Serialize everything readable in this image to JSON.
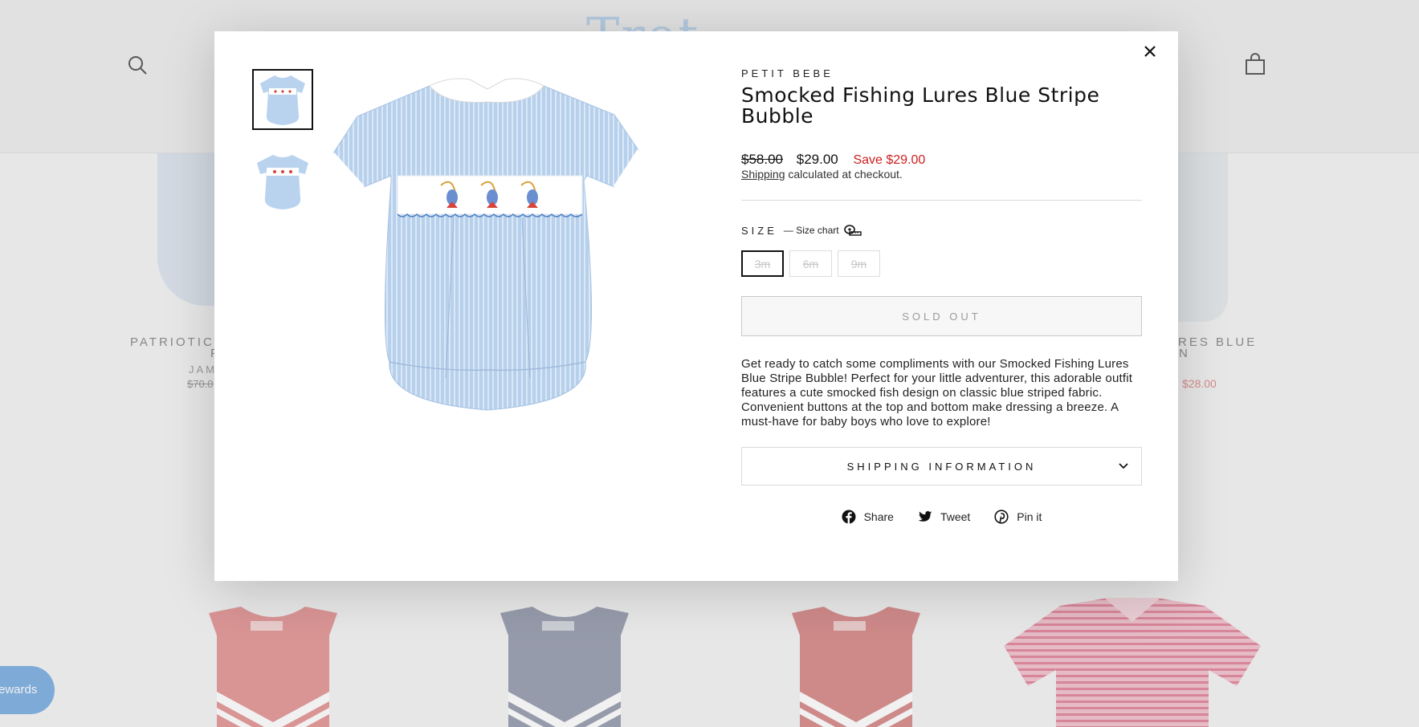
{
  "background": {
    "logo_text": "Trot",
    "cards_top": [
      {
        "title": "PATRIOTIC",
        "subtitle": "F",
        "vendor": "JAM",
        "price_old": "$70.0"
      },
      {
        "title": "RES BLUE",
        "subtitle": "N",
        "price_sale": "$28.00"
      }
    ],
    "rewards_label": "ewards"
  },
  "modal": {
    "close_label": "×",
    "vendor": "PETIT BEBE",
    "title": "Smocked Fishing Lures Blue Stripe Bubble",
    "price_compare": "$58.00",
    "price_current": "$29.00",
    "price_savings": "Save $29.00",
    "shipping_link": "Shipping",
    "shipping_rest": " calculated at checkout.",
    "size_label": "SIZE",
    "size_chart_label": "— Size chart",
    "sizes": [
      "3m",
      "6m",
      "9m"
    ],
    "selected_size": "3m",
    "sold_out_label": "SOLD OUT",
    "description": "Get ready to catch some compliments with our Smocked Fishing Lures Blue Stripe Bubble! Perfect for your little adventurer, this adorable outfit features a cute smocked fish design on classic blue striped fabric. Convenient buttons at the top and bottom make dressing a breeze. A must-have for baby boys who love to explore!",
    "accordion_label": "SHIPPING INFORMATION",
    "share": [
      {
        "label": "Share",
        "icon": "facebook-icon"
      },
      {
        "label": "Tweet",
        "icon": "twitter-icon"
      },
      {
        "label": "Pin it",
        "icon": "pinterest-icon"
      }
    ]
  },
  "colors": {
    "sale_red": "#cc1f1f",
    "romper_blue": "#b9d3ef",
    "rewards_blue": "#7eb0e3"
  }
}
